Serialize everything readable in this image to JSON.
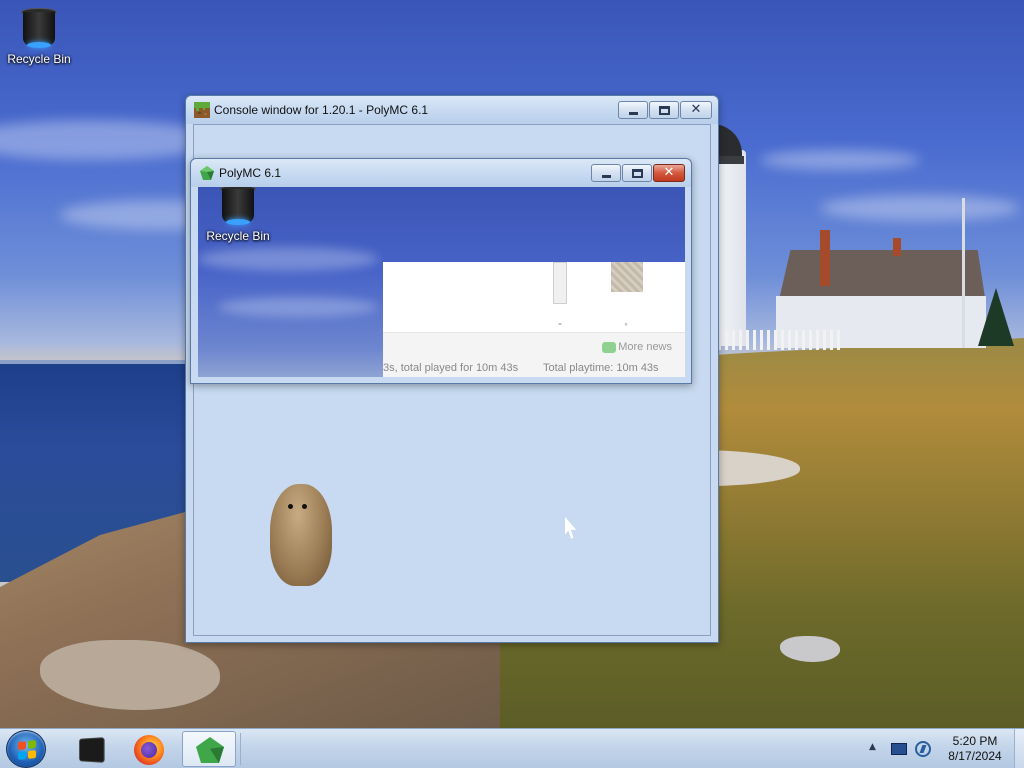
{
  "desktop": {
    "icons": [
      {
        "label": "Recycle Bin",
        "icon": "recycle-bin-icon"
      }
    ]
  },
  "windows": {
    "console": {
      "title": "Console window for 1.20.1 - PolyMC 6.1",
      "icon": "minecraft-grass-block-icon"
    },
    "polymc": {
      "title": "PolyMC 6.1",
      "icon": "polymc-icon",
      "close_glyph": "✕",
      "captured_desktop_icon_label": "Recycle Bin",
      "news": {
        "more_news_label": "More news",
        "scroll_down_glyph": "⌄",
        "dot_glyph": "°"
      },
      "status": {
        "played_text": "3s, total played for 10m 43s",
        "total_text": "Total playtime: 10m 43s"
      }
    }
  },
  "taskbar": {
    "start_icon": "windows-start-icon",
    "pinned": [
      {
        "name": "terminal",
        "icon": "terminal-icon"
      },
      {
        "name": "firefox",
        "icon": "firefox-icon"
      },
      {
        "name": "polymc",
        "icon": "polymc-icon",
        "active": true
      }
    ],
    "tray": {
      "expand_glyph": "▲",
      "icons": [
        "action-center-icon",
        "network-icon"
      ]
    },
    "clock": {
      "time": "5:20 PM",
      "date": "8/17/2024"
    }
  },
  "colors": {
    "accent": "#1f5fb3",
    "close_button": "#c03a20",
    "polymc_green": "#3fa64a"
  }
}
